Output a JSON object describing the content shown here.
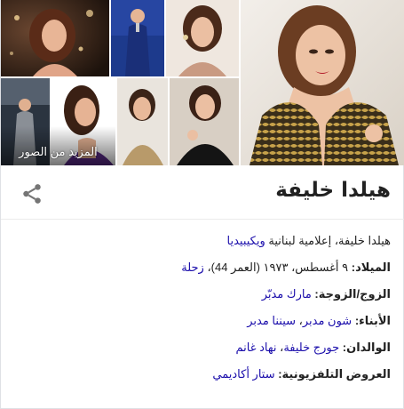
{
  "gallery": {
    "more_images_label": "المزيد من الصور"
  },
  "entity": {
    "title": "هيلدا خليفة",
    "share_icon": "share-icon"
  },
  "description": {
    "text": "هيلدا خليفة، إعلامية لبنانية ",
    "source_link": "ويكيبيديا"
  },
  "facts": {
    "born": {
      "label": "الميلاد:",
      "value": " ٩ أغسطس، ١٩٧٣ (العمر 44)، ",
      "link": "زحلة"
    },
    "spouse": {
      "label": "الزوج/الزوجة:",
      "link": "مارك مدبّر"
    },
    "children": {
      "label": "الأبناء:",
      "link1": "شون مدبر",
      "sep": "، ",
      "link2": "سيننا مدبر"
    },
    "parents": {
      "label": "الوالدان:",
      "link1": "جورج خليفة",
      "sep": "، ",
      "link2": "نهاد غانم"
    },
    "tv_shows": {
      "label": "العروض التلفزيونية:",
      "link": "ستار أكاديمي"
    }
  },
  "colors": {
    "link": "#1a0dab",
    "text": "#222222",
    "divider": "#ebebeb"
  }
}
